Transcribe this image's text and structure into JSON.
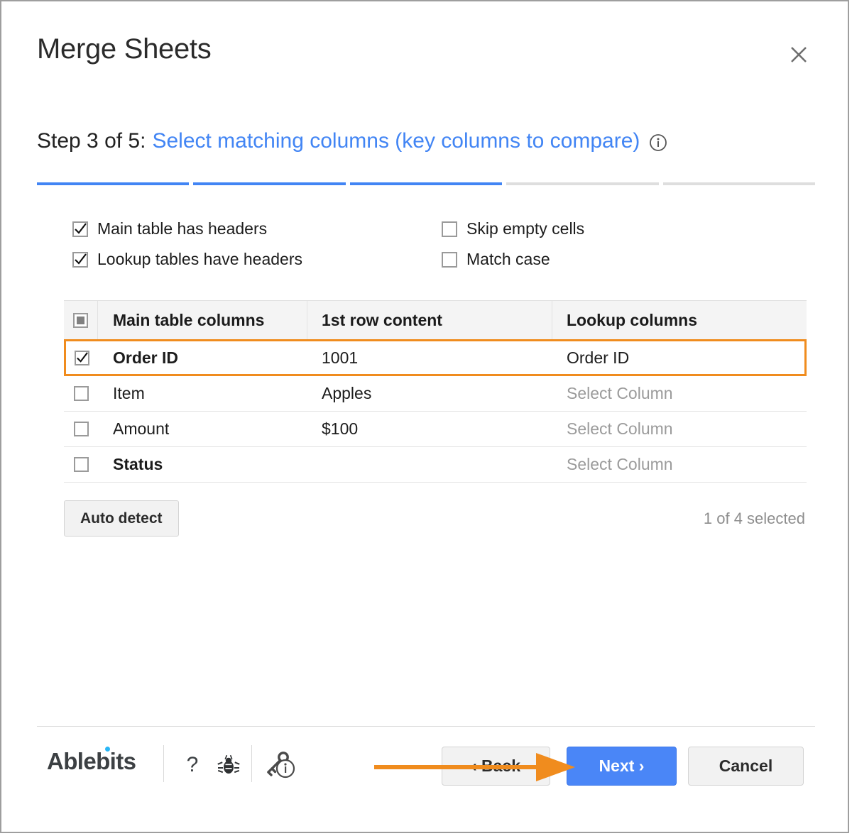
{
  "dialog": {
    "title": "Merge Sheets",
    "close_label": "×",
    "close_icon": "close-icon"
  },
  "step": {
    "prefix": "Step 3 of 5:",
    "title": "Select matching columns (key columns to compare)",
    "info_icon": "info-circle-icon",
    "current": 3,
    "total": 5,
    "segments": [
      "done",
      "done",
      "done",
      "todo",
      "todo"
    ]
  },
  "options": [
    {
      "label": "Main table has headers",
      "checked": true,
      "name": "main-table-has-headers"
    },
    {
      "label": "Skip empty cells",
      "checked": false,
      "name": "skip-empty-cells"
    },
    {
      "label": "Lookup tables have headers",
      "checked": true,
      "name": "lookup-tables-have-headers"
    },
    {
      "label": "Match case",
      "checked": false,
      "name": "match-case"
    }
  ],
  "table": {
    "headers": {
      "select_all": "indeterminate",
      "main_table_columns": "Main table columns",
      "first_row_content": "1st row content",
      "lookup_columns": "Lookup columns"
    },
    "rows": [
      {
        "checked": true,
        "main_column": "Order ID",
        "bold": true,
        "row_content": "1001",
        "lookup_column": "Order ID",
        "lookup_is_placeholder": false,
        "highlighted": true
      },
      {
        "checked": false,
        "main_column": "Item",
        "bold": false,
        "row_content": "Apples",
        "lookup_column": "Select Column",
        "lookup_is_placeholder": true,
        "highlighted": false
      },
      {
        "checked": false,
        "main_column": "Amount",
        "bold": false,
        "row_content": "$100",
        "lookup_column": "Select Column",
        "lookup_is_placeholder": true,
        "highlighted": false
      },
      {
        "checked": false,
        "main_column": "Status",
        "bold": true,
        "row_content": "",
        "lookup_column": "Select Column",
        "lookup_is_placeholder": true,
        "highlighted": false
      }
    ]
  },
  "auto_detect": {
    "label": "Auto detect"
  },
  "selection_status": "1 of 4 selected",
  "footer": {
    "brand": "Ablebits",
    "icons": [
      {
        "name": "help-question-icon",
        "glyph": "?"
      },
      {
        "name": "bug-report-icon",
        "glyph": "bug"
      },
      {
        "name": "license-info-icon",
        "glyph": "key-info"
      }
    ],
    "buttons": {
      "back": "‹ Back",
      "next": "Next ›",
      "cancel": "Cancel"
    }
  },
  "annotation": {
    "type": "arrow",
    "points_to": "next-button",
    "color": "#F08C1E"
  },
  "colors": {
    "accent_blue": "#4285F4",
    "button_blue": "#4A86F7",
    "highlight_orange": "#F08C1E",
    "placeholder_grey": "#9b9b9b",
    "header_bg": "#f4f4f4",
    "brand_dot_blue": "#29b6f6"
  }
}
